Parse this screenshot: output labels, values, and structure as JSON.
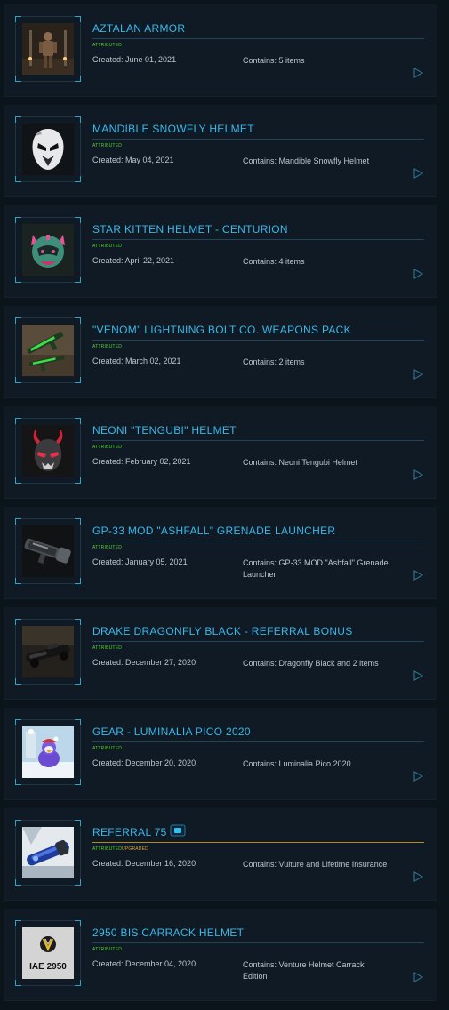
{
  "labels": {
    "created_prefix": "Created: ",
    "contains_prefix": "Contains: ",
    "attributed": "ATTRIBUTED",
    "upgraded": "UPGRADED"
  },
  "items": [
    {
      "title": "AZTALAN ARMOR",
      "tags": [
        "ATTRIBUTED"
      ],
      "created": "Created: June 01, 2021",
      "contains": "Contains: 5 items",
      "thumb": "armor-figure-icon"
    },
    {
      "title": "MANDIBLE SNOWFLY HELMET",
      "tags": [
        "ATTRIBUTED"
      ],
      "created": "Created: May 04, 2021",
      "contains": "Contains: Mandible Snowfly Helmet",
      "thumb": "white-helmet-icon"
    },
    {
      "title": "STAR KITTEN HELMET - CENTURION",
      "tags": [
        "ATTRIBUTED"
      ],
      "created": "Created: April 22, 2021",
      "contains": "Contains: 4 items",
      "thumb": "kitten-helmet-icon"
    },
    {
      "title": "\"VENOM\" LIGHTNING BOLT CO. WEAPONS PACK",
      "tags": [
        "ATTRIBUTED"
      ],
      "created": "Created: March 02, 2021",
      "contains": "Contains: 2 items",
      "thumb": "green-weapons-icon"
    },
    {
      "title": "NEONI \"TENGUBI\" HELMET",
      "tags": [
        "ATTRIBUTED"
      ],
      "created": "Created: February 02, 2021",
      "contains": "Contains: Neoni Tengubi Helmet",
      "thumb": "horned-helmet-icon"
    },
    {
      "title": "GP-33 MOD \"ASHFALL\" GRENADE LAUNCHER",
      "tags": [
        "ATTRIBUTED"
      ],
      "created": "Created: January 05, 2021",
      "contains": "Contains: GP-33 MOD \"Ashfall\" Grenade Launcher",
      "thumb": "grenade-launcher-icon"
    },
    {
      "title": "DRAKE DRAGONFLY BLACK - REFERRAL BONUS",
      "tags": [
        "ATTRIBUTED"
      ],
      "created": "Created: December 27, 2020",
      "contains": "Contains: Dragonfly Black and 2 items",
      "thumb": "dragonfly-bike-icon"
    },
    {
      "title": "GEAR - LUMINALIA PICO 2020",
      "tags": [
        "ATTRIBUTED"
      ],
      "created": "Created: December 20, 2020",
      "contains": "Contains: Luminalia Pico 2020",
      "thumb": "penguin-plush-icon"
    },
    {
      "title": "REFERRAL 75",
      "tags": [
        "ATTRIBUTED",
        "UPGRADED"
      ],
      "created": "Created: December 16, 2020",
      "contains": "Contains: Vulture and Lifetime Insurance",
      "thumb": "vulture-ship-icon",
      "has_badge": true
    },
    {
      "title": "2950 BIS CARRACK HELMET",
      "tags": [
        "ATTRIBUTED"
      ],
      "created": "Created: December 04, 2020",
      "contains": "Contains: Venture Helmet Carrack Edition",
      "thumb": "iae-2950-logo",
      "thumb_text": "IAE 2950"
    }
  ],
  "colors": {
    "title": "#39b8ea",
    "attributed": "#54d431",
    "upgraded": "#e0a431",
    "text": "#bcc6cc",
    "panel": "#0f1a24"
  }
}
